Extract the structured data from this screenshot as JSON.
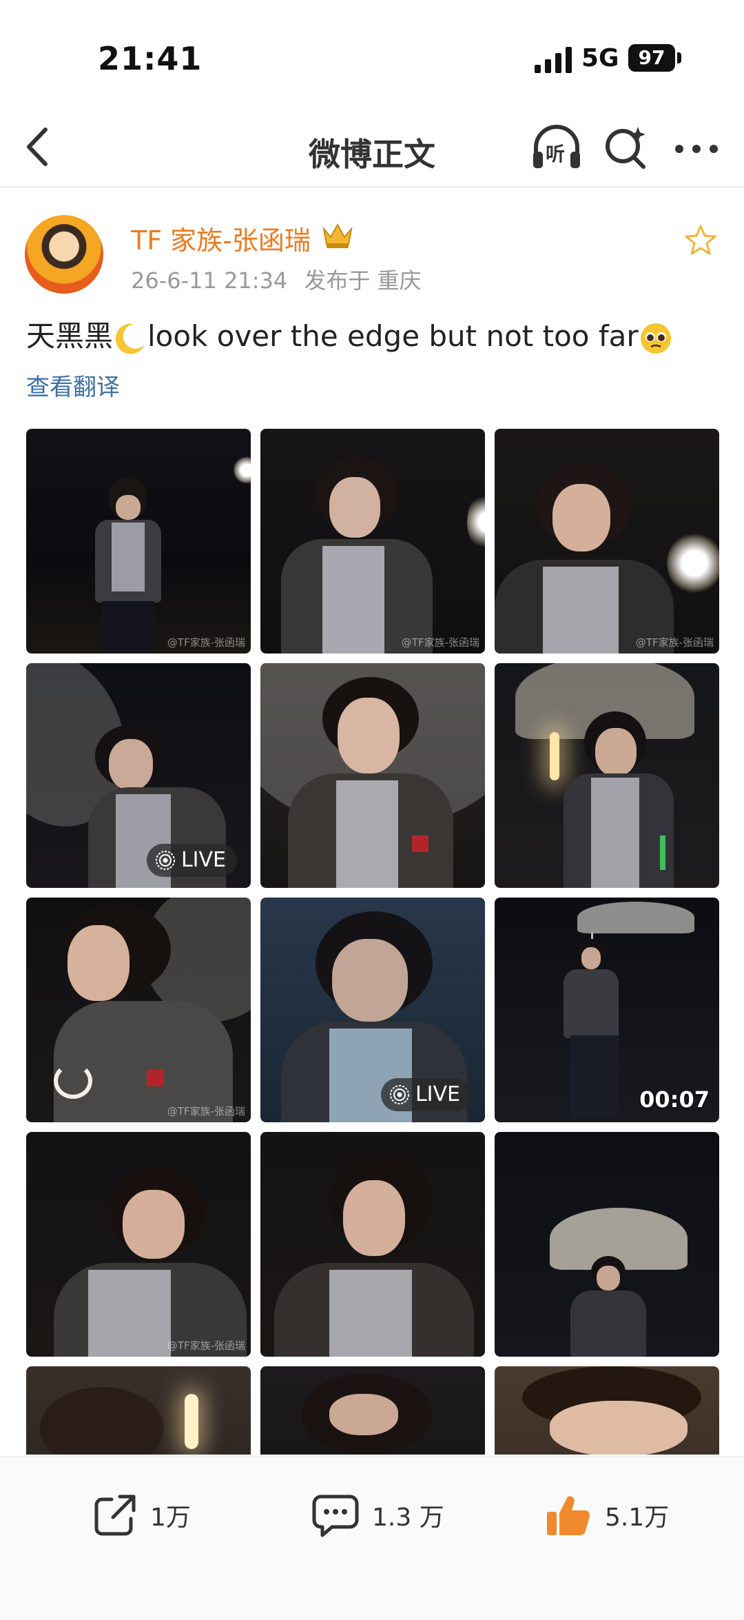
{
  "status_bar": {
    "time": "21:41",
    "network": "5G",
    "battery": "97"
  },
  "nav": {
    "title": "微博正文",
    "listen_label": "听"
  },
  "post": {
    "author": "TF 家族-张函瑞",
    "time": "26-6-11 21:34",
    "location": "发布于 重庆",
    "text_before": "天黑黑",
    "text_after": "look over the edge but not too far",
    "translate": "查看翻译"
  },
  "grid": {
    "live_label": "LIVE",
    "video_duration": "00:07",
    "watermark": "@TF家族-张函瑞"
  },
  "footer": {
    "share_count": "1万",
    "comment_count": "1.3 万",
    "like_count": "5.1万"
  },
  "colors": {
    "author": "#ee7a1f",
    "link": "#3b6fa8",
    "like": "#f08a2c"
  }
}
